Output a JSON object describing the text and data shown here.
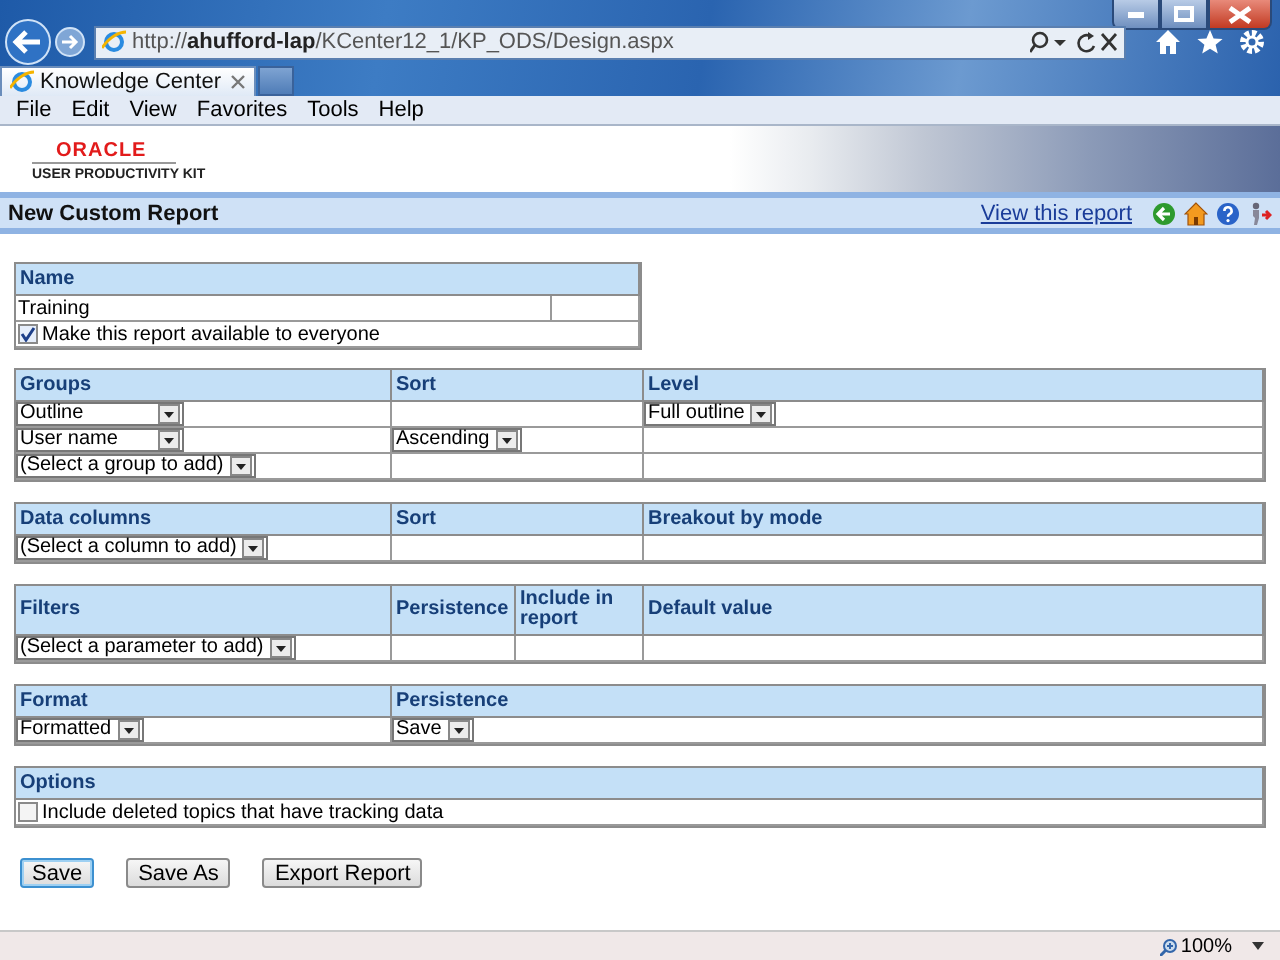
{
  "address_bar": {
    "url": "http://**ahufford-lap**/KCenter12_1/KP_ODS/Design.aspx"
  },
  "tabs": [
    {
      "label": "Knowledge Center",
      "selected": true
    }
  ],
  "menu": [
    "File",
    "Edit",
    "View",
    "Favorites",
    "Tools",
    "Help"
  ],
  "logo": {
    "brand": "ORACLE",
    "product": "USER PRODUCTIVITY KIT"
  },
  "page_header": {
    "title": "New Custom Report",
    "link": "View this report"
  },
  "sections": [
    {
      "kind": "name",
      "columns": [
        "Name"
      ],
      "rows": [
        [
          {
            "kind": "text",
            "value": "Training"
          },
          {
            "kind": "empty"
          }
        ],
        [
          {
            "kind": "checkbox",
            "label": "Make this report available to everyone",
            "checked": true
          }
        ]
      ]
    },
    {
      "kind": "groups",
      "columns": [
        "Groups",
        "Sort",
        "Level"
      ],
      "rows": [
        [
          {
            "kind": "dropdown",
            "value": "Outline"
          },
          {
            "kind": "empty"
          },
          {
            "kind": "dropdown",
            "value": "Full outline"
          }
        ],
        [
          {
            "kind": "dropdown",
            "value": "User name"
          },
          {
            "kind": "dropdown",
            "value": "Ascending"
          },
          {
            "kind": "empty"
          }
        ],
        [
          {
            "kind": "dropdown",
            "value": "(Select a group to add)"
          },
          {
            "kind": "empty"
          },
          {
            "kind": "empty"
          }
        ]
      ]
    },
    {
      "kind": "groups",
      "columns": [
        "Data columns",
        "Sort",
        "Breakout by mode"
      ],
      "rows": [
        [
          {
            "kind": "dropdown",
            "value": "(Select a column to add)"
          },
          {
            "kind": "empty"
          },
          {
            "kind": "empty"
          }
        ]
      ]
    },
    {
      "kind": "filters",
      "columns": [
        "Filters",
        "Persistence",
        "Include in report",
        "Default value"
      ],
      "rows": [
        [
          {
            "kind": "dropdown",
            "value": "(Select a parameter to add)"
          },
          {
            "kind": "empty"
          },
          {
            "kind": "empty"
          },
          {
            "kind": "empty"
          }
        ]
      ]
    },
    {
      "kind": "format",
      "columns": [
        "Format",
        "Persistence"
      ],
      "rows": [
        [
          {
            "kind": "dropdown",
            "value": "Formatted"
          },
          {
            "kind": "dropdown",
            "value": "Save"
          }
        ]
      ]
    },
    {
      "kind": "options",
      "columns": [
        "Options"
      ],
      "rows": [
        [
          {
            "kind": "checkbox",
            "label": "Include deleted topics that have tracking data",
            "checked": false
          }
        ]
      ]
    }
  ],
  "buttons": [
    {
      "label": "Save",
      "focused": true
    },
    {
      "label": "Save As",
      "focused": false
    },
    {
      "label": "Export Report",
      "focused": false
    }
  ],
  "status_bar": {
    "zoom": "100%"
  }
}
